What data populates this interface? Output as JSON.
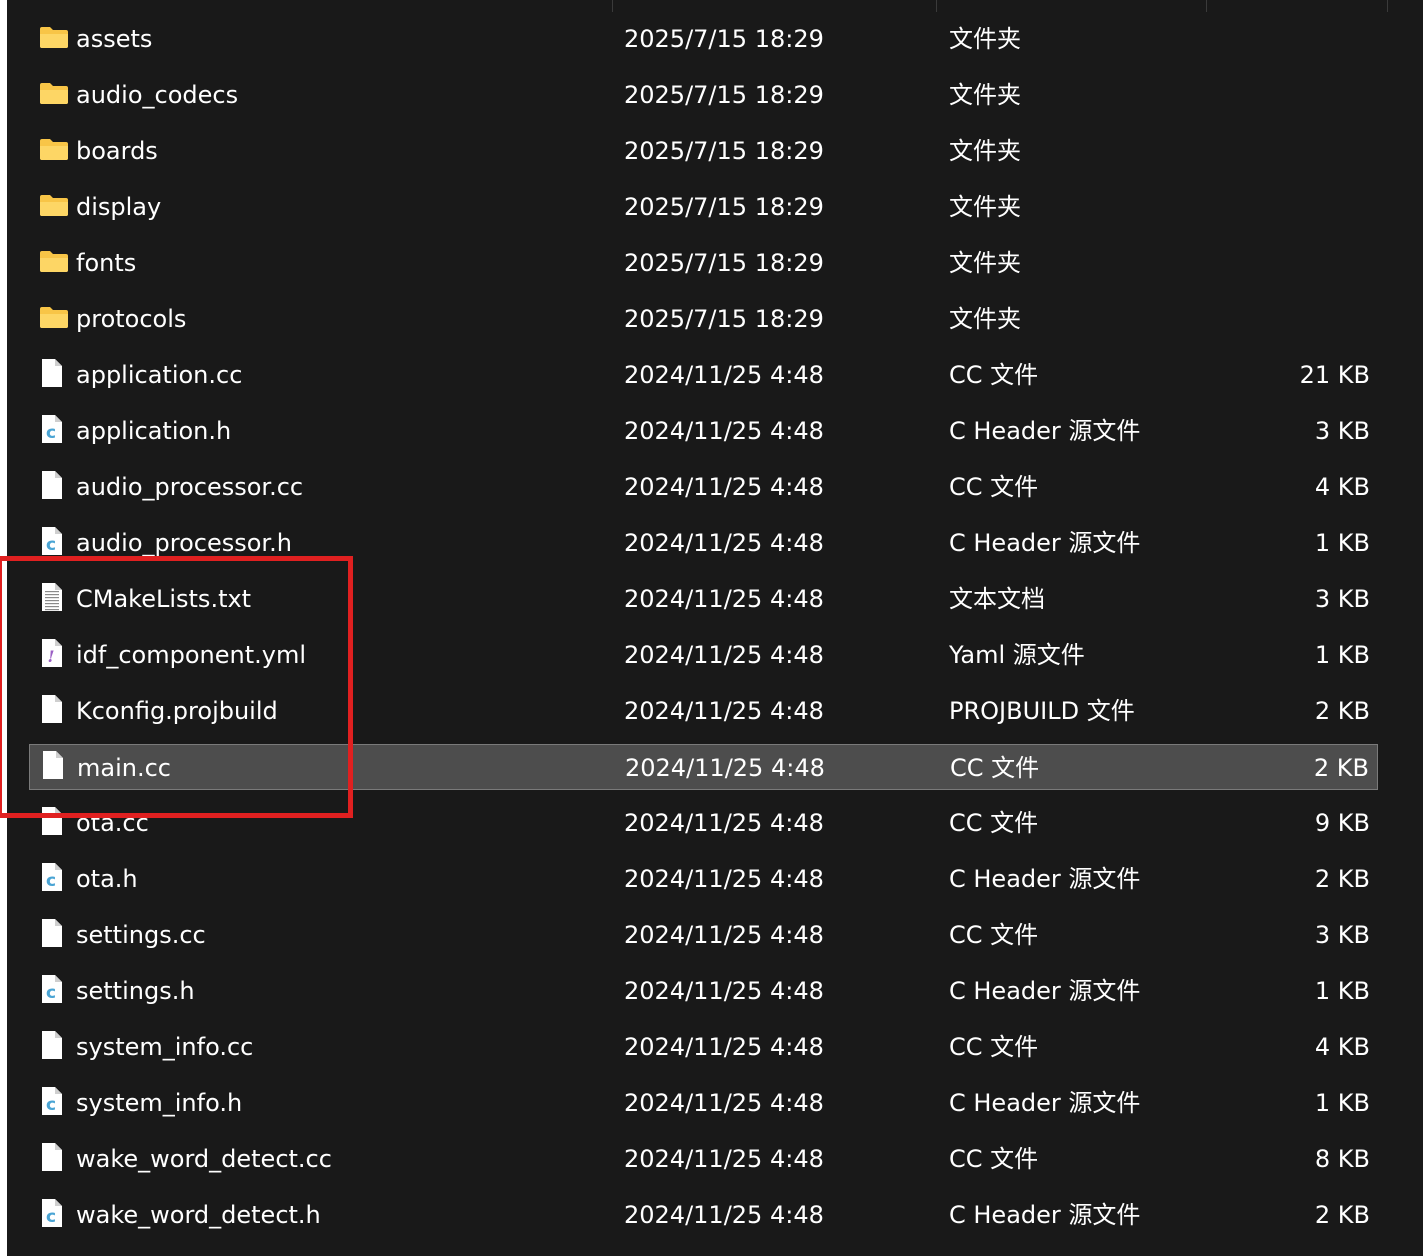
{
  "colors": {
    "background": "#191919",
    "folder": "#f8c547",
    "c_header_icon": "#4aa4d4",
    "yaml_icon": "#9b5fc4",
    "highlight": "#e02020",
    "selection": "#4d4d4d"
  },
  "files": [
    {
      "name": "assets",
      "date": "2025/7/15 18:29",
      "type": "文件夹",
      "size": "",
      "icon": "folder-icon"
    },
    {
      "name": "audio_codecs",
      "date": "2025/7/15 18:29",
      "type": "文件夹",
      "size": "",
      "icon": "folder-icon"
    },
    {
      "name": "boards",
      "date": "2025/7/15 18:29",
      "type": "文件夹",
      "size": "",
      "icon": "folder-icon"
    },
    {
      "name": "display",
      "date": "2025/7/15 18:29",
      "type": "文件夹",
      "size": "",
      "icon": "folder-icon"
    },
    {
      "name": "fonts",
      "date": "2025/7/15 18:29",
      "type": "文件夹",
      "size": "",
      "icon": "folder-icon"
    },
    {
      "name": "protocols",
      "date": "2025/7/15 18:29",
      "type": "文件夹",
      "size": "",
      "icon": "folder-icon"
    },
    {
      "name": "application.cc",
      "date": "2024/11/25 4:48",
      "type": "CC 文件",
      "size": "21 KB",
      "icon": "file-icon"
    },
    {
      "name": "application.h",
      "date": "2024/11/25 4:48",
      "type": "C Header 源文件",
      "size": "3 KB",
      "icon": "c-header-file-icon"
    },
    {
      "name": "audio_processor.cc",
      "date": "2024/11/25 4:48",
      "type": "CC 文件",
      "size": "4 KB",
      "icon": "file-icon"
    },
    {
      "name": "audio_processor.h",
      "date": "2024/11/25 4:48",
      "type": "C Header 源文件",
      "size": "1 KB",
      "icon": "c-header-file-icon"
    },
    {
      "name": "CMakeLists.txt",
      "date": "2024/11/25 4:48",
      "type": "文本文档",
      "size": "3 KB",
      "icon": "text-file-icon"
    },
    {
      "name": "idf_component.yml",
      "date": "2024/11/25 4:48",
      "type": "Yaml 源文件",
      "size": "1 KB",
      "icon": "yaml-file-icon"
    },
    {
      "name": "Kconfig.projbuild",
      "date": "2024/11/25 4:48",
      "type": "PROJBUILD 文件",
      "size": "2 KB",
      "icon": "file-icon"
    },
    {
      "name": "main.cc",
      "date": "2024/11/25 4:48",
      "type": "CC 文件",
      "size": "2 KB",
      "icon": "file-icon",
      "selected": true
    },
    {
      "name": "ota.cc",
      "date": "2024/11/25 4:48",
      "type": "CC 文件",
      "size": "9 KB",
      "icon": "file-icon"
    },
    {
      "name": "ota.h",
      "date": "2024/11/25 4:48",
      "type": "C Header 源文件",
      "size": "2 KB",
      "icon": "c-header-file-icon"
    },
    {
      "name": "settings.cc",
      "date": "2024/11/25 4:48",
      "type": "CC 文件",
      "size": "3 KB",
      "icon": "file-icon"
    },
    {
      "name": "settings.h",
      "date": "2024/11/25 4:48",
      "type": "C Header 源文件",
      "size": "1 KB",
      "icon": "c-header-file-icon"
    },
    {
      "name": "system_info.cc",
      "date": "2024/11/25 4:48",
      "type": "CC 文件",
      "size": "4 KB",
      "icon": "file-icon"
    },
    {
      "name": "system_info.h",
      "date": "2024/11/25 4:48",
      "type": "C Header 源文件",
      "size": "1 KB",
      "icon": "c-header-file-icon"
    },
    {
      "name": "wake_word_detect.cc",
      "date": "2024/11/25 4:48",
      "type": "CC 文件",
      "size": "8 KB",
      "icon": "file-icon"
    },
    {
      "name": "wake_word_detect.h",
      "date": "2024/11/25 4:48",
      "type": "C Header 源文件",
      "size": "2 KB",
      "icon": "c-header-file-icon"
    }
  ]
}
